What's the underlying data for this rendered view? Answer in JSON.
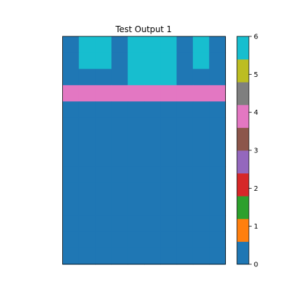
{
  "chart_data": {
    "type": "heatmap",
    "title": "Test Output 1",
    "xlabel": "",
    "ylabel": "",
    "grid": false,
    "rows": 14,
    "cols": 10,
    "values": [
      [
        0,
        6,
        6,
        0,
        6,
        6,
        6,
        0,
        6,
        0
      ],
      [
        0,
        6,
        6,
        0,
        6,
        6,
        6,
        0,
        6,
        0
      ],
      [
        0,
        0,
        0,
        0,
        6,
        6,
        6,
        0,
        0,
        0
      ],
      [
        4,
        4,
        4,
        4,
        4,
        4,
        4,
        4,
        4,
        4
      ],
      [
        0,
        0,
        0,
        0,
        0,
        0,
        0,
        0,
        0,
        0
      ],
      [
        0,
        0,
        0,
        0,
        0,
        0,
        0,
        0,
        0,
        0
      ],
      [
        0,
        0,
        0,
        0,
        0,
        0,
        0,
        0,
        0,
        0
      ],
      [
        0,
        0,
        0,
        0,
        0,
        0,
        0,
        0,
        0,
        0
      ],
      [
        0,
        0,
        0,
        0,
        0,
        0,
        0,
        0,
        0,
        0
      ],
      [
        0,
        0,
        0,
        0,
        0,
        0,
        0,
        0,
        0,
        0
      ],
      [
        0,
        0,
        0,
        0,
        0,
        0,
        0,
        0,
        0,
        0
      ],
      [
        0,
        0,
        0,
        0,
        0,
        0,
        0,
        0,
        0,
        0
      ],
      [
        0,
        0,
        0,
        0,
        0,
        0,
        0,
        0,
        0,
        0
      ],
      [
        0,
        0,
        0,
        0,
        0,
        0,
        0,
        0,
        0,
        0
      ]
    ],
    "colorbar": {
      "range": [
        0,
        6
      ],
      "ticks": [
        "0",
        "1",
        "2",
        "3",
        "4",
        "5",
        "6"
      ],
      "colors": [
        "#1f77b4",
        "#ff7f0e",
        "#2ca02c",
        "#d62728",
        "#9467bd",
        "#8c564b",
        "#e377c2",
        "#7f7f7f",
        "#bcbd22",
        "#17becf"
      ]
    }
  }
}
